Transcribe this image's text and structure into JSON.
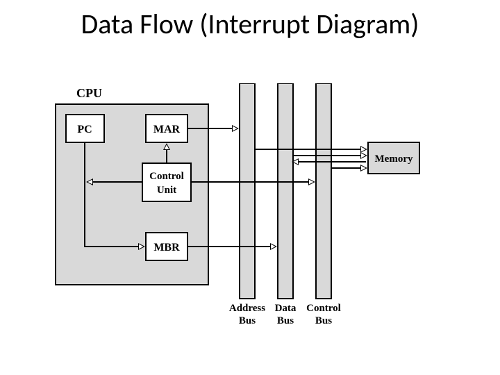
{
  "title": "Data Flow (Interrupt Diagram)",
  "blocks": {
    "cpu": "CPU",
    "pc": "PC",
    "mar": "MAR",
    "cu_line1": "Control",
    "cu_line2": "Unit",
    "mbr": "MBR",
    "memory": "Memory"
  },
  "buses": {
    "addr_line1": "Address",
    "addr_line2": "Bus",
    "data_line1": "Data",
    "data_line2": "Bus",
    "ctrl_line1": "Control",
    "ctrl_line2": "Bus"
  }
}
